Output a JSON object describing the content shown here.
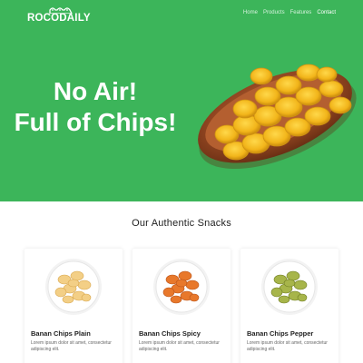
{
  "brand": {
    "name": "ROCODAILY"
  },
  "nav": {
    "items": [
      "Home",
      "Products",
      "Features",
      "Contact"
    ],
    "active": "Contact"
  },
  "hero": {
    "line1": "No Air!",
    "line2": "Full of Chips!",
    "bg_color": "#3cb55a"
  },
  "section": {
    "title": "Our Authentic Snacks"
  },
  "products": [
    {
      "name": "Banan Chips Plain",
      "desc": "Lorem ipsum dolor sit amet, consectetur adipiscing elit."
    },
    {
      "name": "Banan Chips Spicy",
      "desc": "Lorem ipsum dolor sit amet, consectetur adipiscing elit."
    },
    {
      "name": "Banan Chips Pepper",
      "desc": "Lorem ipsum dolor sit amet, consectetur adipiscing elit."
    }
  ]
}
